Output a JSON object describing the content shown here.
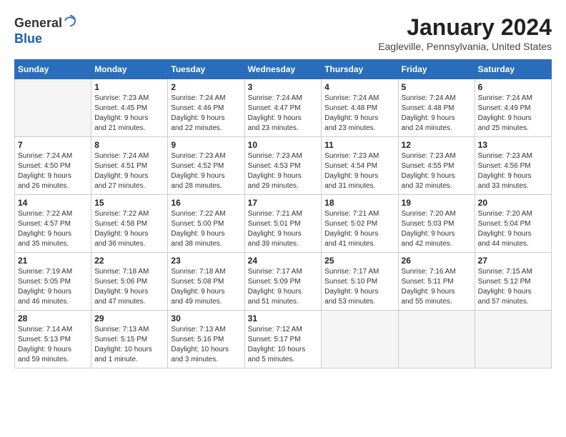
{
  "header": {
    "logo": {
      "line1": "General",
      "line2": "Blue"
    },
    "title": "January 2024",
    "location": "Eagleville, Pennsylvania, United States"
  },
  "weekdays": [
    "Sunday",
    "Monday",
    "Tuesday",
    "Wednesday",
    "Thursday",
    "Friday",
    "Saturday"
  ],
  "weeks": [
    [
      {
        "day": "",
        "info": ""
      },
      {
        "day": "1",
        "info": "Sunrise: 7:23 AM\nSunset: 4:45 PM\nDaylight: 9 hours\nand 21 minutes."
      },
      {
        "day": "2",
        "info": "Sunrise: 7:24 AM\nSunset: 4:46 PM\nDaylight: 9 hours\nand 22 minutes."
      },
      {
        "day": "3",
        "info": "Sunrise: 7:24 AM\nSunset: 4:47 PM\nDaylight: 9 hours\nand 23 minutes."
      },
      {
        "day": "4",
        "info": "Sunrise: 7:24 AM\nSunset: 4:48 PM\nDaylight: 9 hours\nand 23 minutes."
      },
      {
        "day": "5",
        "info": "Sunrise: 7:24 AM\nSunset: 4:48 PM\nDaylight: 9 hours\nand 24 minutes."
      },
      {
        "day": "6",
        "info": "Sunrise: 7:24 AM\nSunset: 4:49 PM\nDaylight: 9 hours\nand 25 minutes."
      }
    ],
    [
      {
        "day": "7",
        "info": "Sunrise: 7:24 AM\nSunset: 4:50 PM\nDaylight: 9 hours\nand 26 minutes."
      },
      {
        "day": "8",
        "info": "Sunrise: 7:24 AM\nSunset: 4:51 PM\nDaylight: 9 hours\nand 27 minutes."
      },
      {
        "day": "9",
        "info": "Sunrise: 7:23 AM\nSunset: 4:52 PM\nDaylight: 9 hours\nand 28 minutes."
      },
      {
        "day": "10",
        "info": "Sunrise: 7:23 AM\nSunset: 4:53 PM\nDaylight: 9 hours\nand 29 minutes."
      },
      {
        "day": "11",
        "info": "Sunrise: 7:23 AM\nSunset: 4:54 PM\nDaylight: 9 hours\nand 31 minutes."
      },
      {
        "day": "12",
        "info": "Sunrise: 7:23 AM\nSunset: 4:55 PM\nDaylight: 9 hours\nand 32 minutes."
      },
      {
        "day": "13",
        "info": "Sunrise: 7:23 AM\nSunset: 4:56 PM\nDaylight: 9 hours\nand 33 minutes."
      }
    ],
    [
      {
        "day": "14",
        "info": "Sunrise: 7:22 AM\nSunset: 4:57 PM\nDaylight: 9 hours\nand 35 minutes."
      },
      {
        "day": "15",
        "info": "Sunrise: 7:22 AM\nSunset: 4:58 PM\nDaylight: 9 hours\nand 36 minutes."
      },
      {
        "day": "16",
        "info": "Sunrise: 7:22 AM\nSunset: 5:00 PM\nDaylight: 9 hours\nand 38 minutes."
      },
      {
        "day": "17",
        "info": "Sunrise: 7:21 AM\nSunset: 5:01 PM\nDaylight: 9 hours\nand 39 minutes."
      },
      {
        "day": "18",
        "info": "Sunrise: 7:21 AM\nSunset: 5:02 PM\nDaylight: 9 hours\nand 41 minutes."
      },
      {
        "day": "19",
        "info": "Sunrise: 7:20 AM\nSunset: 5:03 PM\nDaylight: 9 hours\nand 42 minutes."
      },
      {
        "day": "20",
        "info": "Sunrise: 7:20 AM\nSunset: 5:04 PM\nDaylight: 9 hours\nand 44 minutes."
      }
    ],
    [
      {
        "day": "21",
        "info": "Sunrise: 7:19 AM\nSunset: 5:05 PM\nDaylight: 9 hours\nand 46 minutes."
      },
      {
        "day": "22",
        "info": "Sunrise: 7:18 AM\nSunset: 5:06 PM\nDaylight: 9 hours\nand 47 minutes."
      },
      {
        "day": "23",
        "info": "Sunrise: 7:18 AM\nSunset: 5:08 PM\nDaylight: 9 hours\nand 49 minutes."
      },
      {
        "day": "24",
        "info": "Sunrise: 7:17 AM\nSunset: 5:09 PM\nDaylight: 9 hours\nand 51 minutes."
      },
      {
        "day": "25",
        "info": "Sunrise: 7:17 AM\nSunset: 5:10 PM\nDaylight: 9 hours\nand 53 minutes."
      },
      {
        "day": "26",
        "info": "Sunrise: 7:16 AM\nSunset: 5:11 PM\nDaylight: 9 hours\nand 55 minutes."
      },
      {
        "day": "27",
        "info": "Sunrise: 7:15 AM\nSunset: 5:12 PM\nDaylight: 9 hours\nand 57 minutes."
      }
    ],
    [
      {
        "day": "28",
        "info": "Sunrise: 7:14 AM\nSunset: 5:13 PM\nDaylight: 9 hours\nand 59 minutes."
      },
      {
        "day": "29",
        "info": "Sunrise: 7:13 AM\nSunset: 5:15 PM\nDaylight: 10 hours\nand 1 minute."
      },
      {
        "day": "30",
        "info": "Sunrise: 7:13 AM\nSunset: 5:16 PM\nDaylight: 10 hours\nand 3 minutes."
      },
      {
        "day": "31",
        "info": "Sunrise: 7:12 AM\nSunset: 5:17 PM\nDaylight: 10 hours\nand 5 minutes."
      },
      {
        "day": "",
        "info": ""
      },
      {
        "day": "",
        "info": ""
      },
      {
        "day": "",
        "info": ""
      }
    ]
  ]
}
